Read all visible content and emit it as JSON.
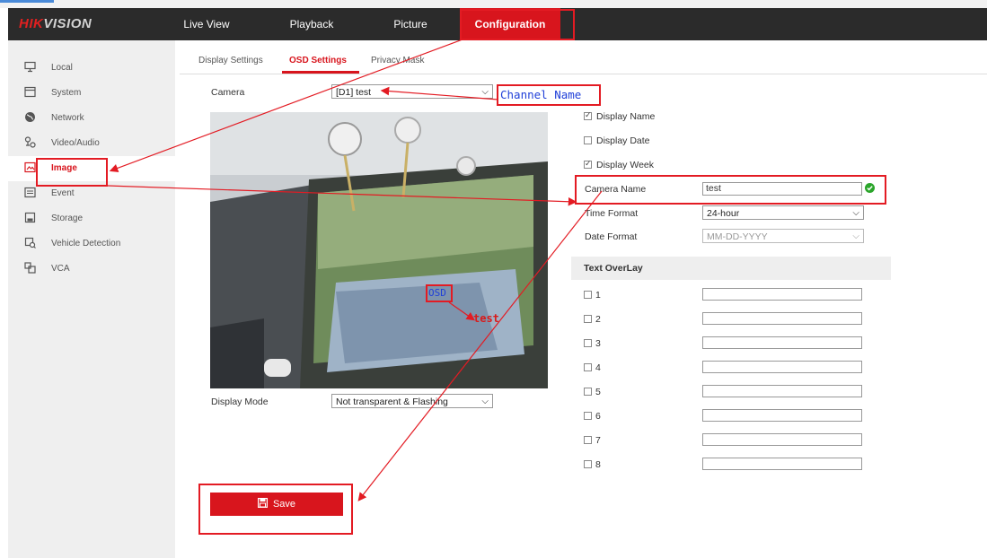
{
  "brand": {
    "prefix": "HIK",
    "suffix": "VISION"
  },
  "nav": [
    {
      "label": "Live View"
    },
    {
      "label": "Playback"
    },
    {
      "label": "Picture"
    },
    {
      "label": "Configuration",
      "active": true
    }
  ],
  "sidebar": [
    {
      "label": "Local",
      "icon": "monitor-icon"
    },
    {
      "label": "System",
      "icon": "system-icon"
    },
    {
      "label": "Network",
      "icon": "globe-icon"
    },
    {
      "label": "Video/Audio",
      "icon": "video-audio-icon"
    },
    {
      "label": "Image",
      "icon": "image-icon",
      "active": true
    },
    {
      "label": "Event",
      "icon": "event-icon"
    },
    {
      "label": "Storage",
      "icon": "storage-icon"
    },
    {
      "label": "Vehicle Detection",
      "icon": "vehicle-icon"
    },
    {
      "label": "VCA",
      "icon": "vca-icon"
    }
  ],
  "tabs": [
    {
      "label": "Display Settings"
    },
    {
      "label": "OSD Settings",
      "active": true
    },
    {
      "label": "Privacy Mask"
    }
  ],
  "form": {
    "camera_label": "Camera",
    "camera_value": "[D1] test",
    "display_mode_label": "Display Mode",
    "display_mode_value": "Not transparent & Flashing",
    "display_name": {
      "label": "Display Name",
      "checked": true
    },
    "display_date": {
      "label": "Display Date",
      "checked": false
    },
    "display_week": {
      "label": "Display Week",
      "checked": true
    },
    "camera_name_label": "Camera Name",
    "camera_name_value": "test",
    "time_format_label": "Time Format",
    "time_format_value": "24-hour",
    "date_format_label": "Date Format",
    "date_format_value": "MM-DD-YYYY",
    "text_overlay_title": "Text OverLay",
    "overlay_items": [
      "1",
      "2",
      "3",
      "4",
      "5",
      "6",
      "7",
      "8"
    ],
    "save_label": "Save"
  },
  "video": {
    "osd_text": "test"
  },
  "annotations": {
    "channel_name": "Channel Name",
    "osd": "OSD"
  },
  "colors": {
    "accent": "#d8151d",
    "annotation": "#e31b23",
    "annotation_text": "#1f3fd8",
    "valid": "#2aa52a"
  }
}
